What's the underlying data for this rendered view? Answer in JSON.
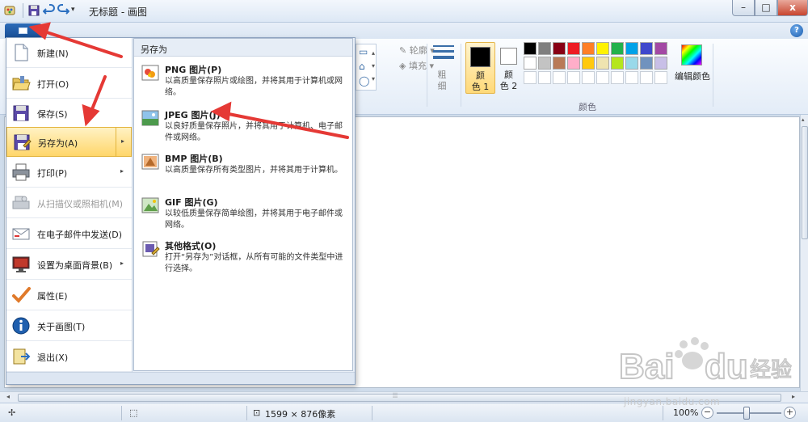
{
  "window": {
    "title": "无标题 - 画图",
    "min_glyph": "–",
    "max_glyph": "□",
    "close_glyph": "x"
  },
  "quick_access": {
    "dropdown_glyph": "▾"
  },
  "help": {
    "glyph": "?"
  },
  "ribbon": {
    "outline_label": "轮廓",
    "fill_label": "填充",
    "size_label": "粗\n细",
    "color1_label": "颜\n色 1",
    "color2_label": "颜\n色 2",
    "edit_colors_label": "编辑颜色",
    "colors_group_label": "颜色",
    "shape_glyphs": [
      "▭",
      "⌂",
      "◯"
    ],
    "palette": [
      "#000000",
      "#7f7f7f",
      "#880015",
      "#ed1c24",
      "#ff7f27",
      "#fff200",
      "#22b14c",
      "#00a2e8",
      "#3f48cc",
      "#a349a4",
      "#ffffff",
      "#c3c3c3",
      "#b97a57",
      "#ffaec9",
      "#ffc90e",
      "#efe4b0",
      "#b5e61d",
      "#99d9ea",
      "#7092be",
      "#c8bfe7",
      "#ffffff",
      "#ffffff",
      "#ffffff",
      "#ffffff",
      "#ffffff",
      "#ffffff",
      "#ffffff",
      "#ffffff",
      "#ffffff",
      "#ffffff"
    ]
  },
  "app_menu": {
    "items": [
      {
        "label": "新建(N)",
        "icon": "new-file-icon"
      },
      {
        "label": "打开(O)",
        "icon": "open-folder-icon"
      },
      {
        "label": "保存(S)",
        "icon": "save-icon"
      },
      {
        "label": "另存为(A)",
        "icon": "save-as-icon",
        "active": true,
        "has_submenu": true
      },
      {
        "label": "打印(P)",
        "icon": "printer-icon",
        "has_submenu": true
      },
      {
        "label": "从扫描仪或照相机(M)",
        "icon": "scanner-icon",
        "disabled": true
      },
      {
        "label": "在电子邮件中发送(D)",
        "icon": "email-icon"
      },
      {
        "label": "设置为桌面背景(B)",
        "icon": "desktop-icon",
        "has_submenu": true
      },
      {
        "label": "属性(E)",
        "icon": "checkmark-icon"
      },
      {
        "label": "关于画图(T)",
        "icon": "info-icon"
      },
      {
        "label": "退出(X)",
        "icon": "exit-icon"
      }
    ],
    "submenu": {
      "header": "另存为",
      "items": [
        {
          "title": "PNG 图片(P)",
          "desc": "以高质量保存照片或绘图，并将其用于计算机或网络。"
        },
        {
          "title": "JPEG 图片(J)",
          "desc": "以良好质量保存照片，并将其用于计算机、电子邮件或网络。"
        },
        {
          "title": "BMP 图片(B)",
          "desc": "以高质量保存所有类型图片，并将其用于计算机。"
        },
        {
          "title": "GIF 图片(G)",
          "desc": "以较低质量保存简单绘图，并将其用于电子邮件或网络。"
        },
        {
          "title": "其他格式(O)",
          "desc": "打开“另存为”对话框，从所有可能的文件类型中进行选择。"
        }
      ]
    },
    "arrow_glyph": "▸"
  },
  "scrollbar": {
    "left_glyph": "◂",
    "right_glyph": "▸",
    "up_glyph": "▴",
    "grip": "⦙⦙⦙"
  },
  "status": {
    "move_glyph": "✢",
    "select_glyph": "⬚",
    "size_glyph": "⊡",
    "dimensions": "1599 × 876像素",
    "zoom": "100%",
    "zoom_out": "−",
    "zoom_in": "+"
  },
  "watermark": {
    "text": "jingyan.baidu.com"
  }
}
